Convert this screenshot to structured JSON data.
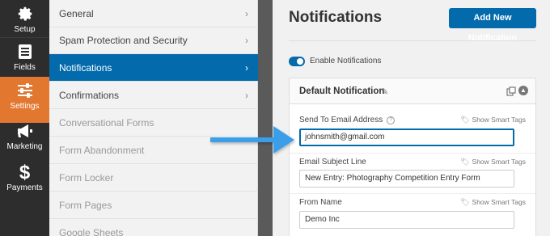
{
  "iconbar": {
    "items": [
      {
        "label": "Setup",
        "icon": "gear-icon"
      },
      {
        "label": "Fields",
        "icon": "fields-list-icon"
      },
      {
        "label": "Settings",
        "icon": "sliders-icon"
      },
      {
        "label": "Marketing",
        "icon": "megaphone-icon"
      },
      {
        "label": "Payments",
        "icon": "dollar-icon"
      }
    ]
  },
  "submenu": {
    "items": [
      {
        "label": "General"
      },
      {
        "label": "Spam Protection and Security"
      },
      {
        "label": "Notifications"
      },
      {
        "label": "Confirmations"
      },
      {
        "label": "Conversational Forms"
      },
      {
        "label": "Form Abandonment"
      },
      {
        "label": "Form Locker"
      },
      {
        "label": "Form Pages"
      },
      {
        "label": "Google Sheets"
      }
    ]
  },
  "main": {
    "title": "Notifications",
    "add_button": "Add New Notification",
    "enable_label": "Enable Notifications",
    "panel": {
      "title": "Default Notification",
      "smart_tags": "Show Smart Tags",
      "fields": [
        {
          "label": "Send To Email Address",
          "value": "johnsmith@gmail.com"
        },
        {
          "label": "Email Subject Line",
          "value": "New Entry: Photography Competition Entry Form"
        },
        {
          "label": "From Name",
          "value": "Demo Inc"
        }
      ]
    }
  },
  "colors": {
    "accent": "#036aab",
    "active_menu": "#e27730",
    "sidebar": "#2d2d2d",
    "arrow": "#3a9ee8"
  }
}
